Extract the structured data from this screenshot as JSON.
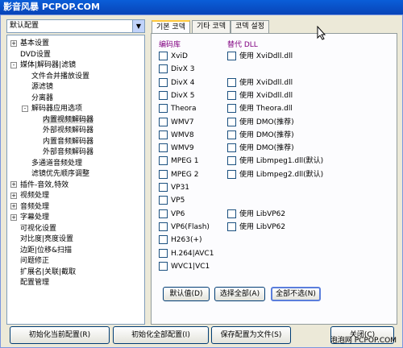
{
  "window": {
    "title": "影音风暴 PCPOP.COM"
  },
  "preset_combo": {
    "value": "默认配置"
  },
  "tree": [
    {
      "label": "基本设置",
      "depth": 0,
      "exp": "+"
    },
    {
      "label": "DVD设置",
      "depth": 0,
      "exp": ""
    },
    {
      "label": "媒体|解码器|滤镜",
      "depth": 0,
      "exp": "-"
    },
    {
      "label": "文件合并播放设置",
      "depth": 1,
      "exp": ""
    },
    {
      "label": "源滤镜",
      "depth": 1,
      "exp": ""
    },
    {
      "label": "分离器",
      "depth": 1,
      "exp": ""
    },
    {
      "label": "解码器应用选项",
      "depth": 1,
      "exp": "-"
    },
    {
      "label": "内置视频解码器",
      "depth": 2,
      "exp": "",
      "selected": true
    },
    {
      "label": "外部视频解码器",
      "depth": 2,
      "exp": ""
    },
    {
      "label": "内置音频解码器",
      "depth": 2,
      "exp": ""
    },
    {
      "label": "外部音频解码器",
      "depth": 2,
      "exp": ""
    },
    {
      "label": "多通道音频处理",
      "depth": 1,
      "exp": ""
    },
    {
      "label": "滤镜优先顺序调整",
      "depth": 1,
      "exp": ""
    },
    {
      "label": "插件-音效,特效",
      "depth": 0,
      "exp": "+"
    },
    {
      "label": "视频处理",
      "depth": 0,
      "exp": "+"
    },
    {
      "label": "音频处理",
      "depth": 0,
      "exp": "+"
    },
    {
      "label": "字幕处理",
      "depth": 0,
      "exp": "+"
    },
    {
      "label": "可视化设置",
      "depth": 0,
      "exp": ""
    },
    {
      "label": "对比度|亮度设置",
      "depth": 0,
      "exp": ""
    },
    {
      "label": "边距|位移&扫描",
      "depth": 0,
      "exp": ""
    },
    {
      "label": "问题修正",
      "depth": 0,
      "exp": ""
    },
    {
      "label": "扩展名|关联|截取",
      "depth": 0,
      "exp": ""
    },
    {
      "label": "配置管理",
      "depth": 0,
      "exp": ""
    }
  ],
  "tabs": [
    "기본 코덱",
    "기타 코덱",
    "코덱 설정"
  ],
  "panel": {
    "col_codec": "编码库",
    "col_alt": "替代 DLL",
    "codecs": [
      "XviD",
      "DivX 3",
      "DivX 4",
      "DivX 5",
      "Theora",
      "WMV7",
      "WMV8",
      "WMV9",
      "MPEG 1",
      "MPEG 2",
      "VP31",
      "VP5",
      "VP6",
      "VP6(Flash)",
      "H263(+)",
      "H.264|AVC1",
      "WVC1|VC1"
    ],
    "alts": [
      {
        "row": 0,
        "label": "使用 XviDdll.dll"
      },
      {
        "row": 2,
        "label": "使用 XviDdll.dll"
      },
      {
        "row": 3,
        "label": "使用 XviDdll.dll"
      },
      {
        "row": 4,
        "label": "使用 Theora.dll"
      },
      {
        "row": 5,
        "label": "使用 DMO(推荐)"
      },
      {
        "row": 6,
        "label": "使用 DMO(推荐)"
      },
      {
        "row": 7,
        "label": "使用 DMO(推荐)"
      },
      {
        "row": 8,
        "label": "使用 Libmpeg1.dll(默认)"
      },
      {
        "row": 9,
        "label": "使用 Libmpeg2.dll(默认)"
      },
      {
        "row": 12,
        "label": "使用 LibVP62"
      },
      {
        "row": 13,
        "label": "使用 LibVP62"
      }
    ],
    "btn_default": "默认值(D)",
    "btn_select_all": "选择全部(A)",
    "btn_select_none": "全部不选(N)"
  },
  "bottom": {
    "init_current": "初始化当前配置(R)",
    "init_all": "初始化全部配置(I)",
    "save_file": "保存配置为文件(S)",
    "close": "关闭(C)"
  },
  "watermark": "泡泡网 PCPOP.COM"
}
